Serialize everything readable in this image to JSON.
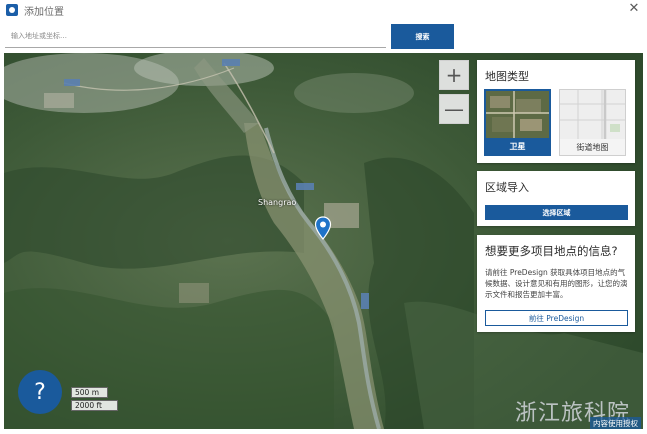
{
  "window": {
    "title": "添加位置",
    "icon": "location-app-icon",
    "close_icon": "close-icon",
    "close_glyph": "✕"
  },
  "search": {
    "placeholder": "输入地址或坐标…",
    "value": "",
    "button_label": "搜索"
  },
  "zoom": {
    "in_glyph": "+",
    "out_glyph": "—"
  },
  "map_type_panel": {
    "title": "地图类型",
    "options": [
      {
        "label": "卫星",
        "selected": true
      },
      {
        "label": "街道地图",
        "selected": false
      }
    ]
  },
  "import_panel": {
    "title": "区域导入",
    "button_label": "选择区域"
  },
  "info_panel": {
    "title": "想要更多项目地点的信息?",
    "body": "请前往 PreDesign 获取具体项目地点的气候数据、设计意见和有用的图形，让您的演示文件和报告更加丰富。",
    "button_label": "前往 PreDesign"
  },
  "map": {
    "place_label": "Shangrao",
    "pin_icon": "map-pin-icon"
  },
  "help": {
    "glyph": "?"
  },
  "scale": {
    "metric": "500 m",
    "imperial": "2000 ft"
  },
  "watermark": "浙江旅科院",
  "license_link": "内容使用授权",
  "colors": {
    "accent": "#1a5a9c",
    "map_forest": "#3f5a3a"
  }
}
